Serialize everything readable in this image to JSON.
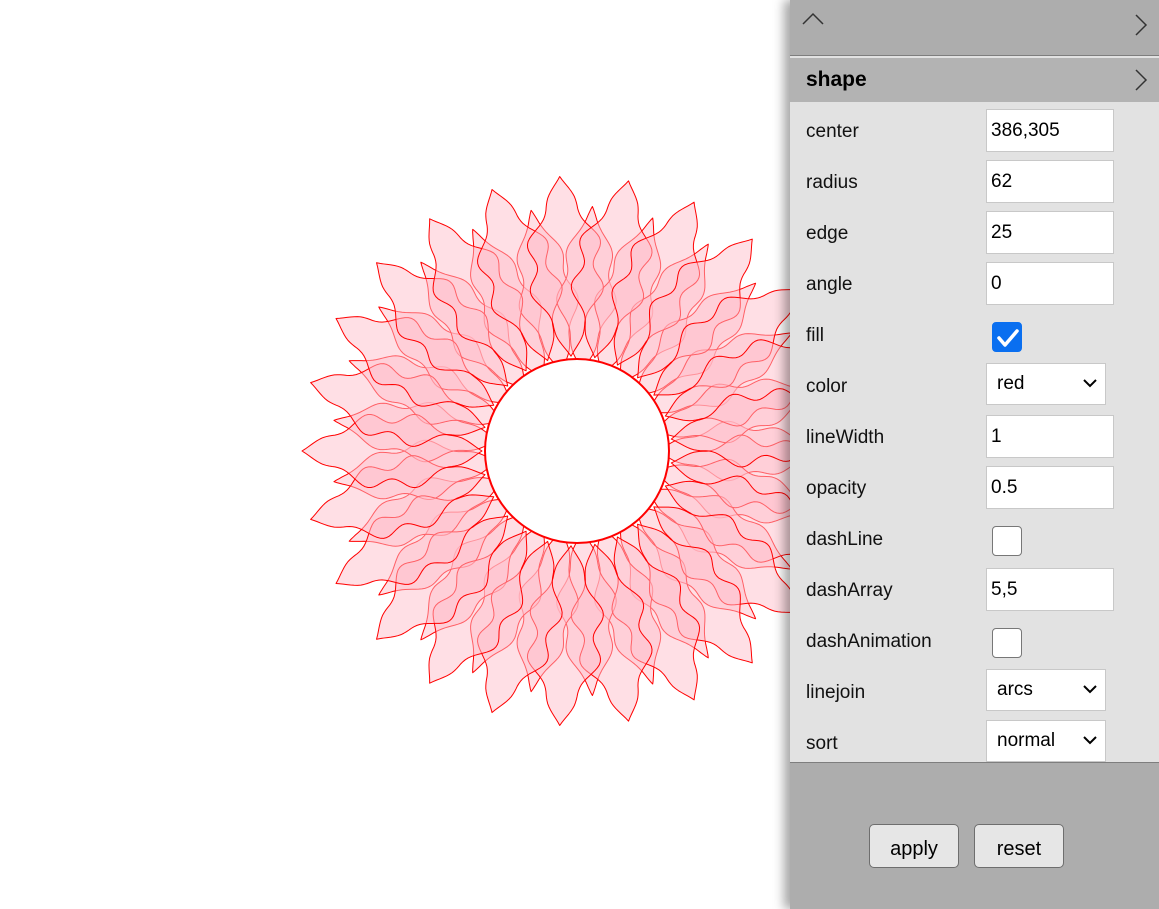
{
  "shape": {
    "center": "386,305",
    "radius": 62,
    "edge": 25,
    "angle": 0,
    "fill": true,
    "color": "red",
    "lineWidth": 1,
    "opacity": 0.5,
    "dashLine": false,
    "dashArray": "5,5",
    "dashAnimation": false,
    "linejoin": "arcs",
    "sort": "normal"
  },
  "colors": {
    "stroke": "#ff0000",
    "fill": "#ffc0cb"
  },
  "panel": {
    "collapse_icon": "chevron-up-icon",
    "expand_icon": "chevron-right-icon",
    "section_title": "shape",
    "fields": {
      "center": {
        "label": "center",
        "value": "386,305"
      },
      "radius": {
        "label": "radius",
        "value": "62"
      },
      "edge": {
        "label": "edge",
        "value": "25"
      },
      "angle": {
        "label": "angle",
        "value": "0"
      },
      "fill": {
        "label": "fill"
      },
      "color": {
        "label": "color",
        "value": "red"
      },
      "lineWidth": {
        "label": "lineWidth",
        "value": "1"
      },
      "opacity": {
        "label": "opacity",
        "value": "0.5"
      },
      "dashLine": {
        "label": "dashLine"
      },
      "dashArray": {
        "label": "dashArray",
        "value": "5,5"
      },
      "dashAnimation": {
        "label": "dashAnimation"
      },
      "linejoin": {
        "label": "linejoin",
        "value": "arcs"
      },
      "sort": {
        "label": "sort",
        "value": "normal"
      }
    },
    "apply_label": "apply",
    "reset_label": "reset"
  }
}
